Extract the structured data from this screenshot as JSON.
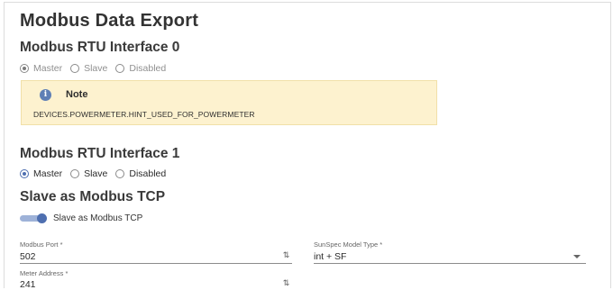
{
  "page": {
    "title": "Modbus Data Export"
  },
  "rtu0": {
    "title": "Modbus RTU Interface 0",
    "options": [
      "Master",
      "Slave",
      "Disabled"
    ],
    "selected": "Master"
  },
  "note": {
    "title": "Note",
    "text": "DEVICES.POWERMETER.HINT_USED_FOR_POWERMETER",
    "icon": "info-icon",
    "color": "#fdf2cf"
  },
  "rtu1": {
    "title": "Modbus RTU Interface 1",
    "options": [
      "Master",
      "Slave",
      "Disabled"
    ],
    "selected": "Master"
  },
  "tcp": {
    "title": "Slave as Modbus TCP",
    "toggle_label": "Slave as Modbus TCP",
    "toggle_on": true
  },
  "fields": {
    "modbus_port": {
      "label": "Modbus Port *",
      "value": "502"
    },
    "sunspec_model": {
      "label": "SunSpec Model Type *",
      "value": "int + SF"
    },
    "meter_address": {
      "label": "Meter Address *",
      "value": "241"
    }
  },
  "colors": {
    "accent": "#4e6fb0",
    "note_bg": "#fdf2cf"
  }
}
